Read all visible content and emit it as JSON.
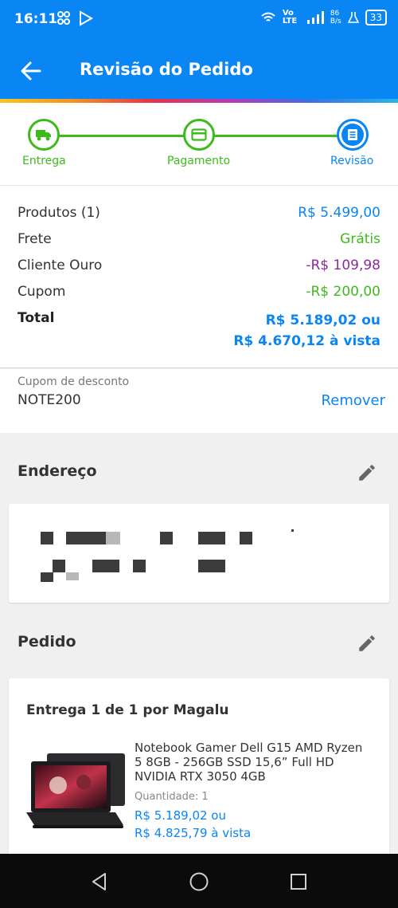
{
  "status": {
    "time": "16:11",
    "network": "Vo LTE",
    "speed_top": "86",
    "speed_bottom": "B/s",
    "battery": "33"
  },
  "header": {
    "title": "Revisão do Pedido"
  },
  "stepper": {
    "steps": [
      {
        "label": "Entrega"
      },
      {
        "label": "Pagamento"
      },
      {
        "label": "Revisão"
      }
    ]
  },
  "summary": {
    "products": {
      "label": "Produtos (1)",
      "value": "R$ 5.499,00"
    },
    "shipping": {
      "label": "Frete",
      "value": "Grátis"
    },
    "gold_client": {
      "label": "Cliente Ouro",
      "value": "-R$ 109,98"
    },
    "coupon": {
      "label": "Cupom",
      "value": "-R$ 200,00"
    },
    "total": {
      "label": "Total",
      "value_installment": "R$ 5.189,02 ou",
      "value_cash": "R$ 4.670,12 à vista"
    }
  },
  "coupon_field": {
    "label": "Cupom de desconto",
    "code": "NOTE200",
    "remove_label": "Remover"
  },
  "address": {
    "title": "Endereço"
  },
  "order": {
    "title": "Pedido",
    "delivery_title": "Entrega 1 de 1 por Magalu",
    "product_name": "Notebook Gamer Dell G15 AMD Ryzen 5 8GB - 256GB SSD 15,6” Full HD NVIDIA RTX 3050 4GB",
    "quantity": "Quantidade: 1",
    "price_installment": "R$ 5.189,02 ou",
    "price_cash": "R$ 4.825,79 à vista"
  },
  "colors": {
    "primary": "#0a86f4",
    "success": "#3ebb1c",
    "gold": "#8c2a9e",
    "text": "#333333"
  }
}
